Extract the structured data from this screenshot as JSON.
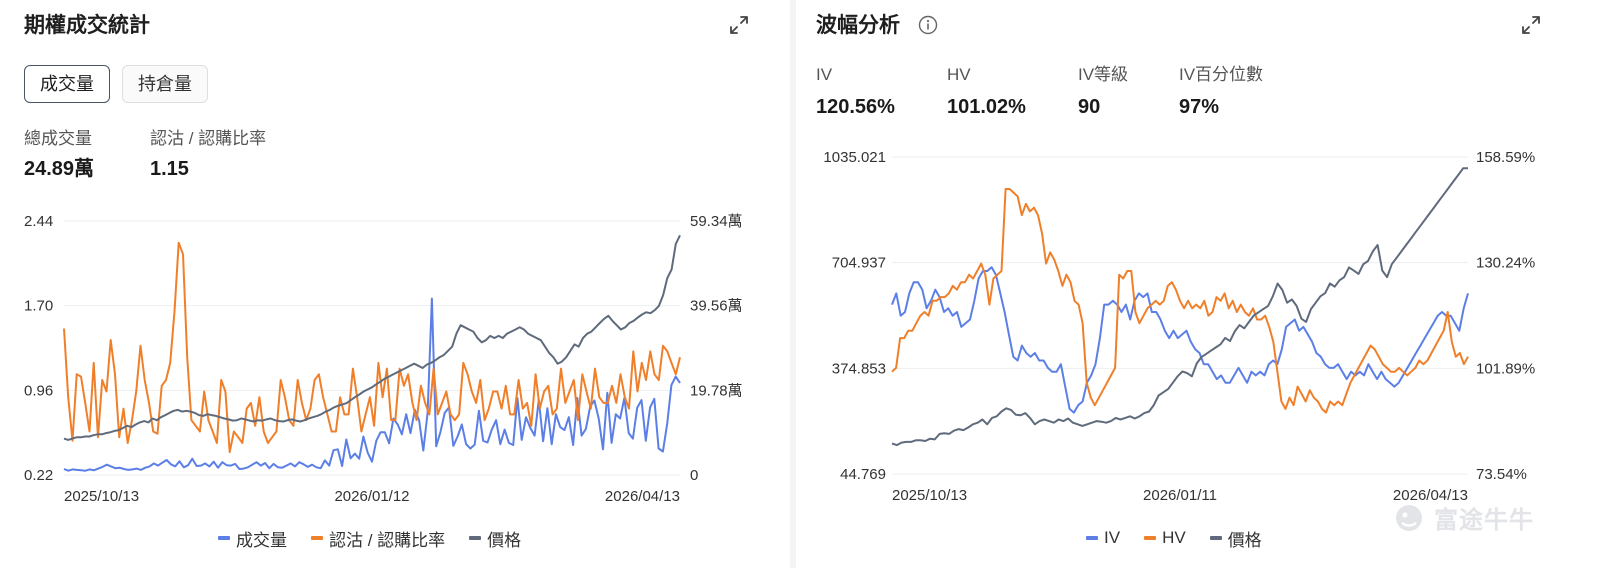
{
  "left": {
    "title": "期權成交統計",
    "tabs": [
      {
        "label": "成交量",
        "active": true
      },
      {
        "label": "持倉量",
        "active": false
      }
    ],
    "stats": [
      {
        "label": "總成交量",
        "value": "24.89萬"
      },
      {
        "label": "認沽 / 認購比率",
        "value": "1.15"
      }
    ],
    "legend": [
      "成交量",
      "認沽 / 認購比率",
      "價格"
    ]
  },
  "right": {
    "title": "波幅分析",
    "stats": [
      {
        "label": "IV",
        "value": "120.56%"
      },
      {
        "label": "HV",
        "value": "101.02%"
      },
      {
        "label": "IV等級",
        "value": "90"
      },
      {
        "label": "IV百分位數",
        "value": "97%"
      }
    ],
    "legend": [
      "IV",
      "HV",
      "價格"
    ]
  },
  "watermark": "富途牛牛",
  "colors": {
    "blue": "#5b7fe6",
    "orange": "#f07f2a",
    "gray": "#5f6b7d",
    "grid": "#eceef1"
  },
  "chart_data": [
    {
      "type": "line",
      "x_ticks": [
        "2025/10/13",
        "2026/01/12",
        "2026/04/13"
      ],
      "y_left_ticks": [
        "2.44",
        "1.70",
        "0.96",
        "0.22"
      ],
      "y_right_ticks": [
        "59.34萬",
        "39.56萬",
        "19.78萬",
        "0"
      ],
      "ylim_left": [
        0.22,
        2.44
      ],
      "ylim_right": [
        0,
        593400
      ],
      "series": [
        {
          "name": "成交量",
          "axis": "right",
          "color": "#5b7fe6",
          "values": [
            14000,
            10000,
            13000,
            12000,
            11000,
            10000,
            13000,
            11000,
            15000,
            19000,
            24000,
            20000,
            16000,
            17000,
            14000,
            12000,
            13000,
            15000,
            12000,
            17000,
            20000,
            27000,
            22000,
            29000,
            35000,
            25000,
            20000,
            32000,
            18000,
            23000,
            38000,
            21000,
            22000,
            27000,
            20000,
            31000,
            17000,
            30000,
            23000,
            22000,
            26000,
            14000,
            15000,
            18000,
            24000,
            30000,
            22000,
            28000,
            16000,
            26000,
            18000,
            17000,
            22000,
            27000,
            20000,
            30000,
            25000,
            19000,
            24000,
            18000,
            16000,
            34000,
            22000,
            58000,
            60000,
            21000,
            83000,
            39000,
            50000,
            38000,
            90000,
            52000,
            31000,
            80000,
            100000,
            100000,
            74000,
            132000,
            118000,
            95000,
            142000,
            98000,
            152000,
            128000,
            57000,
            145000,
            412000,
            67000,
            100000,
            145000,
            158000,
            68000,
            90000,
            118000,
            72000,
            62000,
            71000,
            150000,
            80000,
            76000,
            106000,
            128000,
            72000,
            106000,
            75000,
            70000,
            180000,
            82000,
            135000,
            110000,
            92000,
            176000,
            79000,
            156000,
            72000,
            142000,
            112000,
            105000,
            135000,
            70000,
            180000,
            92000,
            108000,
            160000,
            174000,
            132000,
            60000,
            192000,
            75000,
            142000,
            132000,
            180000,
            98000,
            85000,
            157000,
            175000,
            80000,
            158000,
            178000,
            62000,
            55000,
            120000,
            210000,
            230000,
            215000
          ]
        },
        {
          "name": "認沽 / 認購比率",
          "axis": "left",
          "color": "#f07f2a",
          "values": [
            1.5,
            0.9,
            0.52,
            1.1,
            1.08,
            0.85,
            0.6,
            1.2,
            0.55,
            1.05,
            0.95,
            1.4,
            1.1,
            0.55,
            0.8,
            0.5,
            0.7,
            0.95,
            1.35,
            1.05,
            0.85,
            0.6,
            0.58,
            1.0,
            1.05,
            1.2,
            1.65,
            2.25,
            2.15,
            1.25,
            0.7,
            0.65,
            0.6,
            0.95,
            0.7,
            0.6,
            0.5,
            1.05,
            0.95,
            0.42,
            0.6,
            0.55,
            0.5,
            0.8,
            0.85,
            0.65,
            0.9,
            0.6,
            0.5,
            0.55,
            0.6,
            1.05,
            0.9,
            0.7,
            0.65,
            1.05,
            0.85,
            0.7,
            0.8,
            1.05,
            1.1,
            0.9,
            0.75,
            0.6,
            0.6,
            0.9,
            0.75,
            0.75,
            1.15,
            0.9,
            0.6,
            0.75,
            0.9,
            0.65,
            1.2,
            0.9,
            1.15,
            0.7,
            0.7,
            1.15,
            1.0,
            1.1,
            0.85,
            0.7,
            1.0,
            0.85,
            0.75,
            1.15,
            0.75,
            0.85,
            0.95,
            0.75,
            0.7,
            0.75,
            1.2,
            1.1,
            0.95,
            0.85,
            1.05,
            0.7,
            0.8,
            0.95,
            0.95,
            0.8,
            1.0,
            0.75,
            0.75,
            1.05,
            0.8,
            0.85,
            0.65,
            1.1,
            0.8,
            0.95,
            1.0,
            0.75,
            0.8,
            1.15,
            0.85,
            0.95,
            1.05,
            0.7,
            1.1,
            0.95,
            0.8,
            1.15,
            0.9,
            0.85,
            0.85,
            1.0,
            0.85,
            1.1,
            0.9,
            0.8,
            1.3,
            0.95,
            1.2,
            1.05,
            1.3,
            1.1,
            1.05,
            1.35,
            1.3,
            1.2,
            1.1,
            1.25
          ]
        },
        {
          "name": "價格",
          "axis": "right",
          "color": "#5f6b7d",
          "values": [
            85000,
            82000,
            85000,
            88000,
            88000,
            90000,
            90000,
            93000,
            95000,
            95000,
            98000,
            100000,
            103000,
            105000,
            110000,
            115000,
            112000,
            118000,
            123000,
            126000,
            123000,
            132000,
            128000,
            135000,
            140000,
            145000,
            150000,
            152000,
            148000,
            150000,
            148000,
            145000,
            140000,
            138000,
            142000,
            140000,
            138000,
            135000,
            132000,
            130000,
            127000,
            128000,
            132000,
            130000,
            127000,
            125000,
            128000,
            127000,
            130000,
            132000,
            128000,
            126000,
            125000,
            128000,
            130000,
            127000,
            125000,
            128000,
            132000,
            135000,
            138000,
            142000,
            148000,
            152000,
            158000,
            162000,
            165000,
            168000,
            175000,
            182000,
            188000,
            195000,
            200000,
            205000,
            212000,
            218000,
            225000,
            230000,
            235000,
            240000,
            245000,
            250000,
            255000,
            260000,
            255000,
            250000,
            258000,
            262000,
            268000,
            275000,
            280000,
            290000,
            300000,
            330000,
            350000,
            345000,
            340000,
            335000,
            320000,
            310000,
            315000,
            325000,
            320000,
            325000,
            320000,
            330000,
            335000,
            340000,
            345000,
            340000,
            330000,
            325000,
            320000,
            315000,
            300000,
            285000,
            275000,
            260000,
            265000,
            275000,
            290000,
            305000,
            300000,
            320000,
            330000,
            335000,
            345000,
            355000,
            365000,
            372000,
            360000,
            350000,
            340000,
            345000,
            355000,
            360000,
            368000,
            375000,
            380000,
            378000,
            385000,
            395000,
            420000,
            460000,
            480000,
            540000,
            560000
          ]
        }
      ]
    },
    {
      "type": "line",
      "x_ticks": [
        "2025/10/13",
        "2026/01/11",
        "2026/04/13"
      ],
      "y_left_ticks": [
        "1035.021",
        "704.937",
        "374.853",
        "44.769"
      ],
      "y_right_ticks": [
        "158.59%",
        "130.24%",
        "101.89%",
        "73.54%"
      ],
      "ylim_left": [
        44.769,
        1035.021
      ],
      "ylim_right": [
        73.54,
        158.59
      ],
      "series": [
        {
          "name": "IV",
          "axis": "right",
          "color": "#5b7fe6",
          "values": [
            119,
            122,
            116,
            117,
            122,
            125,
            125,
            123,
            118,
            120,
            123,
            121,
            117,
            118,
            116,
            117,
            113,
            114,
            115,
            120,
            126,
            128,
            128,
            129,
            127,
            122,
            117,
            111,
            105,
            104,
            108,
            106,
            105,
            106,
            104,
            104,
            102,
            101,
            101,
            103,
            97,
            91,
            90,
            92,
            93,
            98,
            100,
            103,
            110,
            119,
            119,
            120,
            119,
            117,
            119,
            115,
            120,
            122,
            121,
            122,
            117,
            117,
            115,
            112,
            110,
            112,
            110,
            111,
            112,
            109,
            107,
            106,
            103,
            103,
            101,
            99,
            100,
            98,
            98,
            100,
            102,
            100,
            98,
            101,
            100,
            101,
            100,
            103,
            104,
            103,
            107,
            113,
            114,
            115,
            112,
            113,
            111,
            109,
            106,
            105,
            103,
            102,
            102,
            103,
            101,
            99,
            101,
            100,
            101,
            100,
            103,
            101,
            99,
            101,
            99,
            98,
            97,
            98,
            100,
            102,
            104,
            106,
            108,
            110,
            112,
            114,
            116,
            117,
            116,
            116,
            114,
            112,
            118,
            122
          ]
        },
        {
          "name": "HV",
          "axis": "right",
          "color": "#f07f2a",
          "values": [
            101,
            102,
            110,
            110,
            112,
            112,
            114,
            116,
            117,
            116,
            120,
            120,
            121,
            121,
            122,
            124,
            123,
            125,
            125,
            127,
            126,
            128,
            130,
            127,
            119,
            126,
            127,
            128,
            150,
            150,
            149,
            148,
            143,
            146,
            144,
            145,
            143,
            138,
            130,
            133,
            131,
            128,
            124,
            127,
            125,
            120,
            119,
            114,
            98,
            94,
            92,
            94,
            96,
            98,
            100,
            102,
            127,
            126,
            128,
            128,
            117,
            114,
            116,
            118,
            119,
            120,
            119,
            120,
            124,
            125,
            123,
            120,
            118,
            120,
            118,
            119,
            118,
            120,
            116,
            117,
            121,
            120,
            122,
            118,
            120,
            117,
            119,
            117,
            116,
            118,
            115,
            115,
            116,
            113,
            109,
            101,
            93,
            91,
            94,
            92,
            97,
            95,
            93,
            96,
            94,
            93,
            91,
            90,
            93,
            92,
            93,
            92,
            95,
            98,
            100,
            102,
            104,
            106,
            108,
            107,
            105,
            103,
            102,
            101,
            101,
            102,
            101,
            100,
            101,
            102,
            104,
            103,
            104,
            106,
            108,
            110,
            112,
            117,
            109,
            105,
            106,
            103,
            105
          ]
        },
        {
          "name": "價格",
          "axis": "left",
          "color": "#5f6b7d",
          "values": [
            140,
            135,
            143,
            145,
            145,
            150,
            150,
            148,
            155,
            153,
            170,
            172,
            170,
            180,
            185,
            182,
            190,
            200,
            205,
            215,
            200,
            220,
            225,
            240,
            250,
            245,
            230,
            228,
            235,
            220,
            200,
            210,
            215,
            210,
            205,
            215,
            210,
            218,
            205,
            200,
            195,
            200,
            205,
            210,
            208,
            205,
            210,
            220,
            215,
            220,
            225,
            218,
            225,
            235,
            240,
            260,
            290,
            300,
            310,
            330,
            350,
            365,
            360,
            350,
            390,
            410,
            420,
            430,
            440,
            450,
            470,
            460,
            490,
            510,
            500,
            520,
            540,
            550,
            560,
            570,
            600,
            640,
            620,
            580,
            590,
            570,
            530,
            520,
            560,
            580,
            600,
            610,
            640,
            630,
            650,
            660,
            690,
            680,
            670,
            700,
            710,
            740,
            760,
            680,
            660,
            700,
            720,
            740,
            760,
            780,
            800,
            820,
            840,
            860,
            880,
            900,
            920,
            940,
            960,
            980,
            1000,
            1000
          ]
        }
      ]
    }
  ]
}
